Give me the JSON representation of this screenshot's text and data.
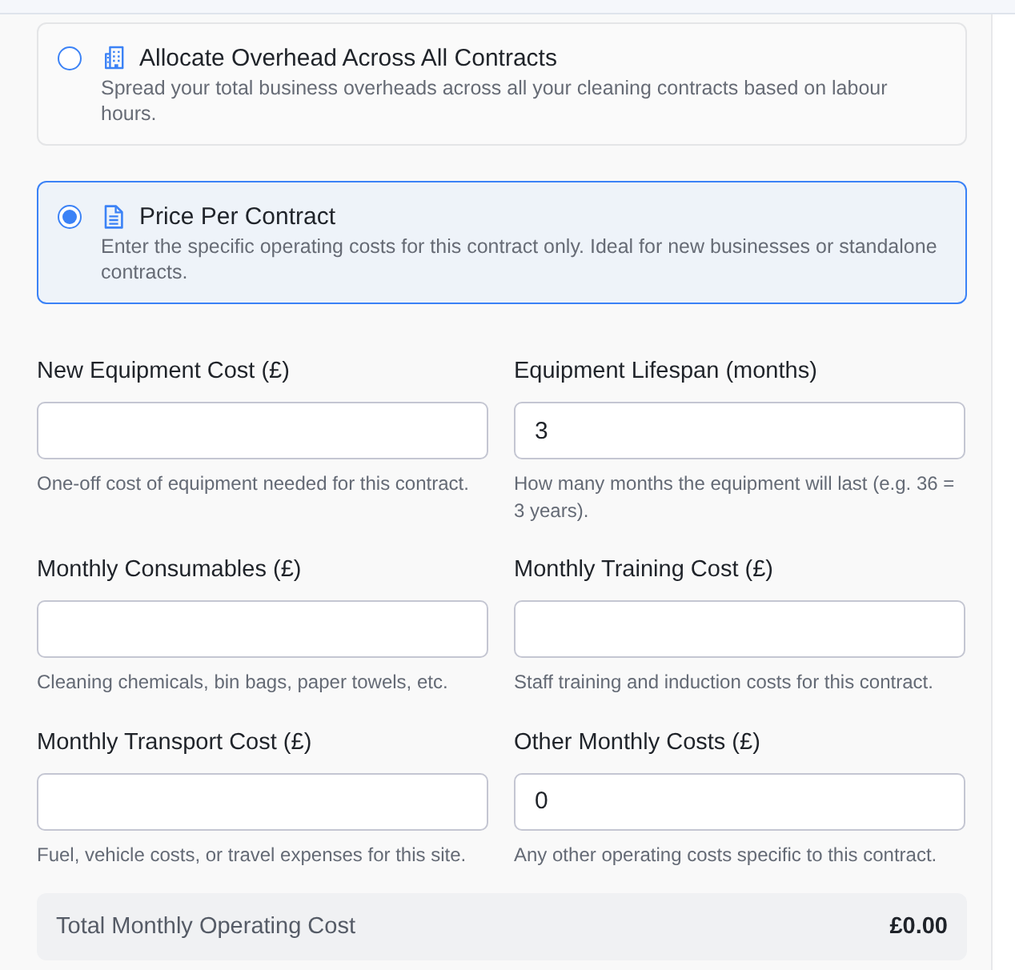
{
  "pricing_options": [
    {
      "title": "Allocate Overhead Across All Contracts",
      "description": "Spread your total business overheads across all your cleaning contracts based on labour hours.",
      "selected": false
    },
    {
      "title": "Price Per Contract",
      "description": "Enter the specific operating costs for this contract only. Ideal for new businesses or standalone contracts.",
      "selected": true
    }
  ],
  "fields": [
    {
      "label": "New Equipment Cost (£)",
      "help": "One-off cost of equipment needed for this contract."
    },
    {
      "label": "Equipment Lifespan (months)",
      "value": "3",
      "help": "How many months the equipment will last (e.g. 36 = 3 years)."
    },
    {
      "label": "Monthly Consumables (£)",
      "help": "Cleaning chemicals, bin bags, paper towels, etc."
    },
    {
      "label": "Monthly Training Cost (£)",
      "help": "Staff training and induction costs for this contract."
    },
    {
      "label": "Monthly Transport Cost (£)",
      "help": "Fuel, vehicle costs, or travel expenses for this site."
    },
    {
      "label": "Other Monthly Costs (£)",
      "value": "0",
      "help": "Any other operating costs specific to this contract."
    }
  ],
  "total": {
    "label": "Total Monthly Operating Cost",
    "value": "£0.00"
  }
}
